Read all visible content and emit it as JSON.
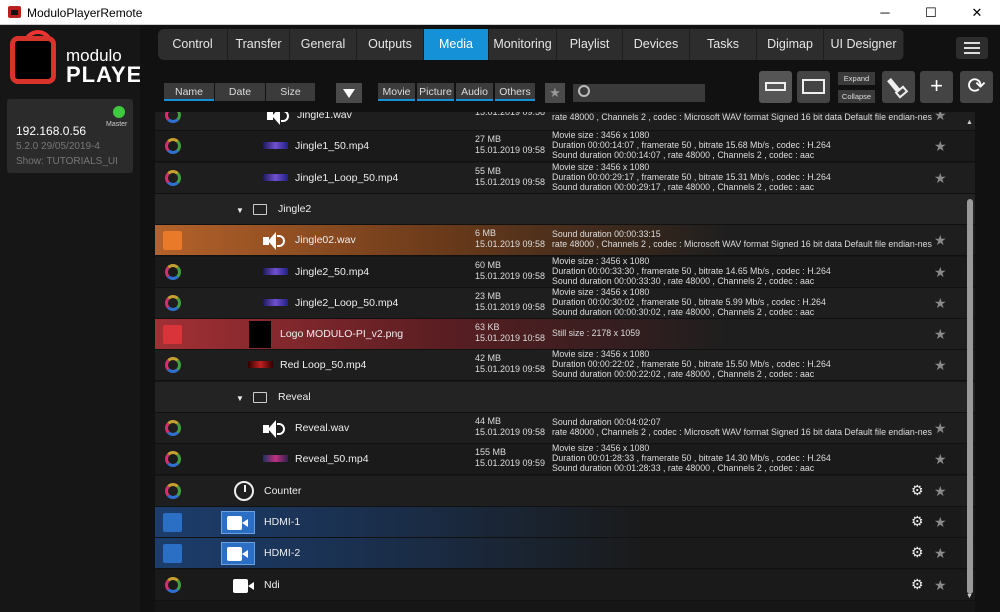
{
  "window": {
    "title": "ModuloPlayerRemote",
    "min": "─",
    "max": "☐",
    "close": "✕"
  },
  "sidebar": {
    "logo_top": "modulo",
    "logo_bottom": "PLAYER",
    "device": {
      "ip": "192.168.0.56",
      "version": "5.2.0 29/05/2019-4",
      "show": "Show: TUTORIALS_UI",
      "role": "Master"
    }
  },
  "tabs": [
    {
      "label": "Control",
      "w": 70
    },
    {
      "label": "Transfer",
      "w": 62
    },
    {
      "label": "General",
      "w": 67
    },
    {
      "label": "Outputs",
      "w": 67
    },
    {
      "label": "Media",
      "w": 65
    },
    {
      "label": "Monitoring",
      "w": 68
    },
    {
      "label": "Playlist",
      "w": 66
    },
    {
      "label": "Devices",
      "w": 67
    },
    {
      "label": "Tasks",
      "w": 67
    },
    {
      "label": "Digimap",
      "w": 67
    },
    {
      "label": "UI Designer",
      "w": 80
    }
  ],
  "sort": {
    "name": "Name",
    "date": "Date",
    "size": "Size"
  },
  "filters": {
    "movie": "Movie",
    "picture": "Picture",
    "audio": "Audio",
    "others": "Others"
  },
  "search": {
    "placeholder": ""
  },
  "tools": {
    "expand": "Expand",
    "collapse": "Collapse",
    "add": "+",
    "refresh": "⟳"
  },
  "rows": [
    {
      "name": "Jingle1.wav",
      "size": "",
      "date": "15.01.2019 09:58",
      "info": [
        "rate 48000 , Channels 2 , codec : Microsoft WAV format Signed 16 bit data Default file endian-ness"
      ]
    },
    {
      "name": "Jingle1_50.mp4",
      "size": "27 MB",
      "date": "15.01.2019 09:58",
      "info": [
        "Movie size : 3456 x 1080",
        "Duration 00:00:14:07 , framerate 50 , bitrate 15.68 Mb/s , codec : H.264",
        "Sound duration 00:00:14:07 , rate 48000 , Channels 2 , codec : aac"
      ]
    },
    {
      "name": "Jingle1_Loop_50.mp4",
      "size": "55 MB",
      "date": "15.01.2019 09:58",
      "info": [
        "Movie size : 3456 x 1080",
        "Duration 00:00:29:17 , framerate 50 , bitrate 15.31 Mb/s , codec : H.264",
        "Sound duration 00:00:29:17 , rate 48000 , Channels 2 , codec : aac"
      ]
    },
    {
      "name": "Jingle2"
    },
    {
      "name": "Jingle02.wav",
      "size": "6 MB",
      "date": "15.01.2019 09:58",
      "info": [
        "Sound duration 00:00:33:15",
        "rate 48000 , Channels 2 , codec : Microsoft WAV format Signed 16 bit data Default file endian-ness"
      ]
    },
    {
      "name": "Jingle2_50.mp4",
      "size": "60 MB",
      "date": "15.01.2019 09:58",
      "info": [
        "Movie size : 3456 x 1080",
        "Duration 00:00:33:30 , framerate 50 , bitrate 14.65 Mb/s , codec : H.264",
        "Sound duration 00:00:33:30 , rate 48000 , Channels 2 , codec : aac"
      ]
    },
    {
      "name": "Jingle2_Loop_50.mp4",
      "size": "23 MB",
      "date": "15.01.2019 09:58",
      "info": [
        "Movie size : 3456 x 1080",
        "Duration 00:00:30:02 , framerate 50 , bitrate 5.99 Mb/s , codec : H.264",
        "Sound duration 00:00:30:02 , rate 48000 , Channels 2 , codec : aac"
      ]
    },
    {
      "name": "Logo MODULO-PI_v2.png",
      "size": "63 KB",
      "date": "15.01.2019 10:58",
      "info": [
        "Still size : 2178 x 1059"
      ]
    },
    {
      "name": "Red Loop_50.mp4",
      "size": "42 MB",
      "date": "15.01.2019 09:58",
      "info": [
        "Movie size : 3456 x 1080",
        "Duration 00:00:22:02 , framerate 50 , bitrate 15.50 Mb/s , codec : H.264",
        "Sound duration 00:00:22:02 , rate 48000 , Channels 2 , codec : aac"
      ]
    },
    {
      "name": "Reveal"
    },
    {
      "name": "Reveal.wav",
      "size": "44 MB",
      "date": "15.01.2019 09:58",
      "info": [
        "Sound duration 00:04:02:07",
        "rate 48000 , Channels 2 , codec : Microsoft WAV format Signed 16 bit data Default file endian-ness"
      ]
    },
    {
      "name": "Reveal_50.mp4",
      "size": "155 MB",
      "date": "15.01.2019 09:59",
      "info": [
        "Movie size : 3456 x 1080",
        "Duration 00:01:28:33 , framerate 50 , bitrate 14.30 Mb/s , codec : H.264",
        "Sound duration 00:01:28:33 , rate 48000 , Channels 2 , codec : aac"
      ]
    },
    {
      "name": "Counter"
    },
    {
      "name": "HDMI-1"
    },
    {
      "name": "HDMI-2"
    },
    {
      "name": "Ndi"
    }
  ],
  "colors": {
    "accent": "#1591d8",
    "orange": "#e87a2a",
    "red": "#d9343a",
    "blue": "#2a6fc4"
  }
}
